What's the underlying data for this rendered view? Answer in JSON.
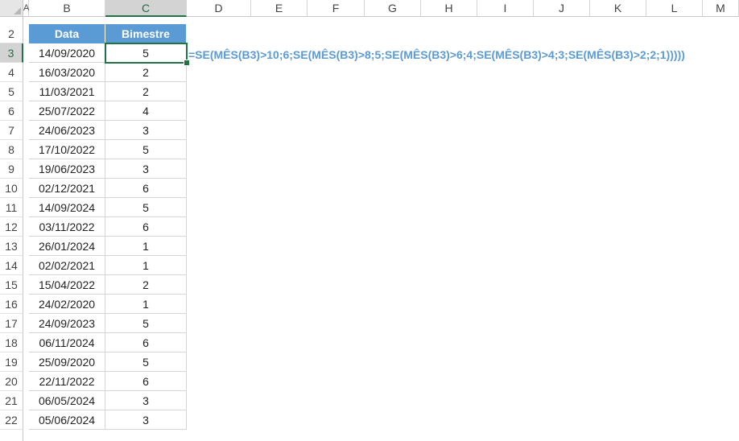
{
  "columns": [
    "A",
    "B",
    "C",
    "D",
    "E",
    "F",
    "G",
    "H",
    "I",
    "J",
    "K",
    "L",
    "M"
  ],
  "rows": [
    2,
    3,
    4,
    5,
    6,
    7,
    8,
    9,
    10,
    11,
    12,
    13,
    14,
    15,
    16,
    17,
    18,
    19,
    20,
    21,
    22
  ],
  "selected_column": "C",
  "selected_row": 3,
  "table": {
    "headers": [
      "Data",
      "Bimestre"
    ],
    "data_rows": [
      [
        "14/09/2020",
        "5"
      ],
      [
        "16/03/2020",
        "2"
      ],
      [
        "11/03/2021",
        "2"
      ],
      [
        "25/07/2022",
        "4"
      ],
      [
        "24/06/2023",
        "3"
      ],
      [
        "17/10/2022",
        "5"
      ],
      [
        "19/06/2023",
        "3"
      ],
      [
        "02/12/2021",
        "6"
      ],
      [
        "14/09/2024",
        "5"
      ],
      [
        "03/11/2022",
        "6"
      ],
      [
        "26/01/2024",
        "1"
      ],
      [
        "02/02/2021",
        "1"
      ],
      [
        "15/04/2022",
        "2"
      ],
      [
        "24/02/2020",
        "1"
      ],
      [
        "24/09/2023",
        "5"
      ],
      [
        "06/11/2024",
        "6"
      ],
      [
        "25/09/2020",
        "5"
      ],
      [
        "22/11/2022",
        "6"
      ],
      [
        "06/05/2024",
        "3"
      ],
      [
        "05/06/2024",
        "3"
      ]
    ]
  },
  "formula_annotation": "=SE(MÊS(B3)>10;6;SE(MÊS(B3)>8;5;SE(MÊS(B3)>6;4;SE(MÊS(B3)>4;3;SE(MÊS(B3)>2;2;1)))))",
  "colors": {
    "table_header_bg": "#5b9bd5",
    "formula_text": "#5b9bd5",
    "selection": "#217346"
  }
}
